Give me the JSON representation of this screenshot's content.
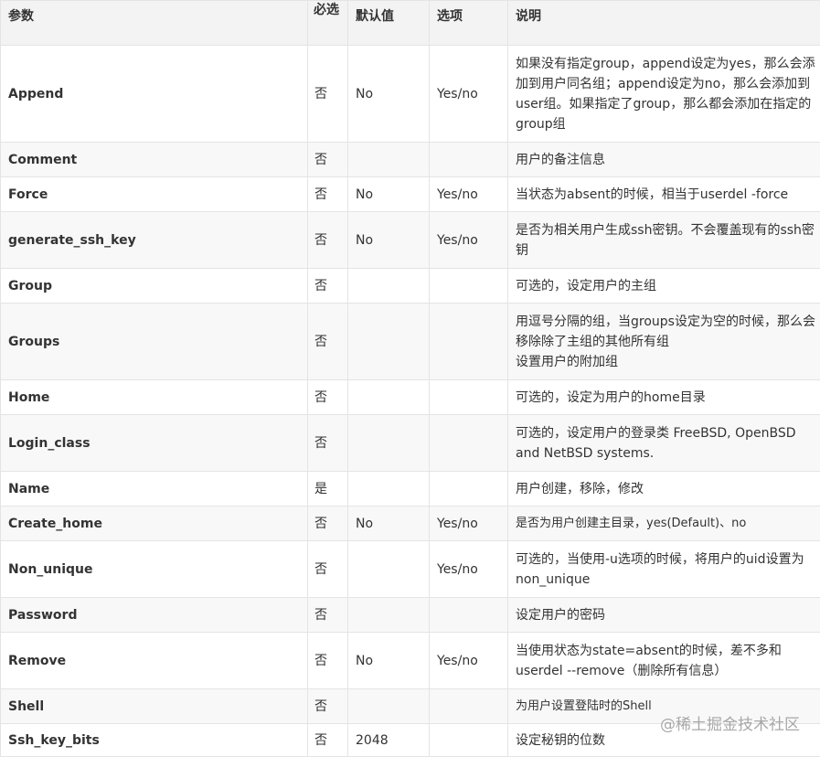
{
  "headers": {
    "param": "参数",
    "required": "必选",
    "default": "默认值",
    "options": "选项",
    "description": "说明"
  },
  "rows": [
    {
      "param": "Append",
      "required": "否",
      "default": "No",
      "options": "Yes/no",
      "description": "如果没有指定group，append设定为yes，那么会添加到用户同名组；append设定为no，那么会添加到user组。如果指定了group，那么都会添加在指定的group组"
    },
    {
      "param": "Comment",
      "required": "否",
      "default": "",
      "options": "",
      "description": "用户的备注信息"
    },
    {
      "param": "Force",
      "required": "否",
      "default": "No",
      "options": "Yes/no",
      "description": "当状态为absent的时候，相当于userdel -force"
    },
    {
      "param": "generate_ssh_key",
      "required": "否",
      "default": "No",
      "options": "Yes/no",
      "description": "是否为相关用户生成ssh密钥。不会覆盖现有的ssh密钥"
    },
    {
      "param": "Group",
      "required": "否",
      "default": "",
      "options": "",
      "description": "可选的，设定用户的主组"
    },
    {
      "param": "Groups",
      "required": "否",
      "default": "",
      "options": "",
      "description": "用逗号分隔的组，当groups设定为空的时候，那么会移除除了主组的其他所有组\n设置用户的附加组"
    },
    {
      "param": "Home",
      "required": "否",
      "default": "",
      "options": "",
      "description": "可选的，设定为用户的home目录"
    },
    {
      "param": "Login_class",
      "required": "否",
      "default": "",
      "options": "",
      "description": "可选的，设定用户的登录类 FreeBSD, OpenBSD and NetBSD systems."
    },
    {
      "param": "Name",
      "required": "是",
      "default": "",
      "options": "",
      "description": "用户创建，移除，修改"
    },
    {
      "param": "Create_home",
      "required": "否",
      "default": "No",
      "options": "Yes/no",
      "description": "是否为用户创建主目录，yes(Default)、no"
    },
    {
      "param": "Non_unique",
      "required": "否",
      "default": "",
      "options": "Yes/no",
      "description": "可选的，当使用-u选项的时候，将用户的uid设置为non_unique"
    },
    {
      "param": "Password",
      "required": "否",
      "default": "",
      "options": "",
      "description": "设定用户的密码"
    },
    {
      "param": "Remove",
      "required": "否",
      "default": "No",
      "options": "Yes/no",
      "description": "当使用状态为state=absent的时候，差不多和userdel --remove（删除所有信息）"
    },
    {
      "param": "Shell",
      "required": "否",
      "default": "",
      "options": "",
      "description": "为用户设置登陆时的Shell"
    },
    {
      "param": "Ssh_key_bits",
      "required": "否",
      "default": "2048",
      "options": "",
      "description": "设定秘钥的位数"
    }
  ],
  "watermark": "@稀土掘金技术社区"
}
